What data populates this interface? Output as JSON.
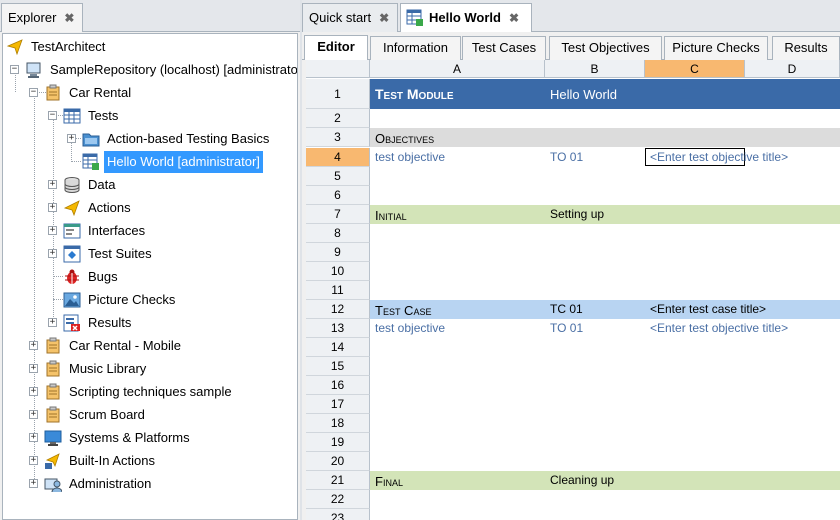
{
  "explorer": {
    "tab_label": "Explorer",
    "tab_close": "✖",
    "tree": [
      {
        "label": "TestArchitect",
        "icon": "arrow-icon"
      },
      {
        "label": "SampleRepository (localhost) [administrato",
        "icon": "computer-icon"
      },
      {
        "label": "Car Rental",
        "icon": "project-icon"
      },
      {
        "label": "Tests",
        "icon": "tests-folder-icon"
      },
      {
        "label": "Action-based Testing Basics",
        "icon": "folder-icon"
      },
      {
        "label": "Hello World [administrator]",
        "icon": "test-module-icon"
      },
      {
        "label": "Data",
        "icon": "database-icon"
      },
      {
        "label": "Actions",
        "icon": "actions-icon"
      },
      {
        "label": "Interfaces",
        "icon": "interfaces-icon"
      },
      {
        "label": "Test Suites",
        "icon": "test-suites-icon"
      },
      {
        "label": "Bugs",
        "icon": "bug-icon"
      },
      {
        "label": "Picture Checks",
        "icon": "picture-icon"
      },
      {
        "label": "Results",
        "icon": "results-icon"
      },
      {
        "label": "Car Rental - Mobile",
        "icon": "project-icon"
      },
      {
        "label": "Music Library",
        "icon": "project-icon"
      },
      {
        "label": "Scripting techniques sample",
        "icon": "project-icon"
      },
      {
        "label": "Scrum Board",
        "icon": "project-icon"
      },
      {
        "label": "Systems & Platforms",
        "icon": "monitor-icon"
      },
      {
        "label": "Built-In Actions",
        "icon": "built-in-actions-icon"
      },
      {
        "label": "Administration",
        "icon": "administration-icon"
      }
    ]
  },
  "editor": {
    "tabs": [
      {
        "label": "Quick start",
        "close": "✖"
      },
      {
        "label": "Hello World",
        "close": "✖"
      }
    ],
    "subtabs": [
      "Editor",
      "Information",
      "Test Cases",
      "Test Objectives",
      "Picture Checks",
      "Results"
    ],
    "columns": [
      "A",
      "B",
      "C",
      "D"
    ],
    "rows": [
      "1",
      "2",
      "3",
      "4",
      "5",
      "6",
      "7",
      "8",
      "9",
      "10",
      "11",
      "12",
      "13",
      "14",
      "15",
      "16",
      "17",
      "18",
      "19",
      "20",
      "21",
      "22",
      "23"
    ],
    "cells": {
      "r1a": "Test Module",
      "r1b": "Hello World",
      "r3a": "Objectives",
      "r4a": "test objective",
      "r4b": "TO 01",
      "r4c": "<Enter test objective title>",
      "r7a": "Initial",
      "r7b": "Setting up",
      "r12a": "Test Case",
      "r12b": "TC 01",
      "r12c": "<Enter test case title>",
      "r13a": "test objective",
      "r13b": "TO 01",
      "r13c": "<Enter test objective title>",
      "r21a": "Final",
      "r21b": "Cleaning up"
    },
    "selected_row": "4",
    "selected_column": "C"
  },
  "colors": {
    "module_band": "#3a6aa8",
    "section_gray": "#dcdcdc",
    "initial_green": "#d3e4b8",
    "testcase_blue": "#b8d4f2",
    "selection_orange": "#f8b870",
    "tree_selection": "#3399ff"
  }
}
